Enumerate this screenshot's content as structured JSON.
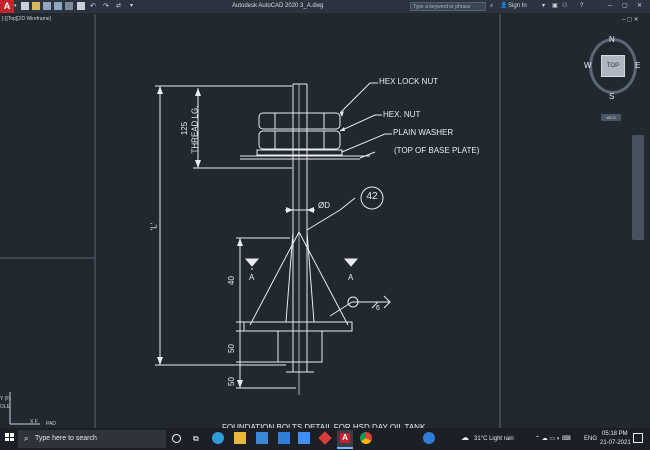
{
  "app": {
    "title": "Autodesk AutoCAD 2020    3_A.dwg",
    "search_placeholder": "Type a keyword or phrase",
    "sign_in": "Sign In"
  },
  "viewport": {
    "label": "[-][Top][2D Wireframe]",
    "viewcube": {
      "n": "N",
      "s": "S",
      "e": "E",
      "w": "W",
      "face": "TOP",
      "wcs": "WCS"
    },
    "side_labels": {
      "f": "Y (F)",
      "ole": "OLE",
      "pad": "PAD",
      "xf": "X F"
    }
  },
  "drawing": {
    "annotations": {
      "hex_lock_nut": "HEX LOCK NUT",
      "hex_nut": "HEX.  NUT",
      "plain_washer": "PLAIN WASHER",
      "top_base_plate": "(TOP OF BASE PLATE)",
      "dia": "ØD",
      "bubble": "42",
      "weld_size": "6"
    },
    "dimensions": {
      "thread_len": "125",
      "thread_label": "THREAD LG.",
      "overall": "'L'",
      "d40": "40",
      "d50a": "50",
      "d50b": "50"
    },
    "section_marks": {
      "left": "A",
      "right": "A"
    },
    "bottom_title": "FOUNDATION BOLTS DETAIL FOR HSD DAY OIL TANK"
  },
  "taskbar": {
    "search_placeholder": "Type here to search",
    "weather": "31°C  Light rain",
    "lang": "ENG",
    "time": "05:18 PM",
    "date": "21-07-2021"
  },
  "colors": {
    "canvas": "#212830",
    "line": "#e8ecf0",
    "accent": "#c0252b"
  }
}
